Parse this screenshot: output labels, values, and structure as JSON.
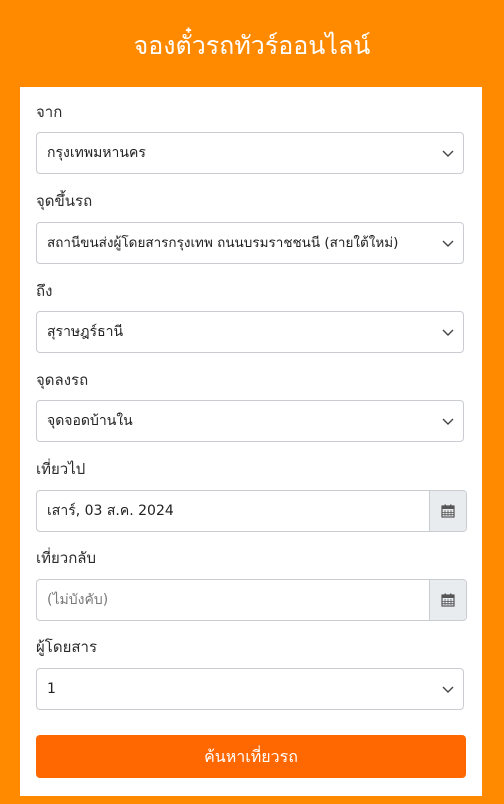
{
  "header": {
    "title": "จองตั๋วรถทัวร์ออนไลน์"
  },
  "form": {
    "from": {
      "label": "จาก",
      "value": "กรุงเทพมหานคร"
    },
    "pickup": {
      "label": "จุดขึ้นรถ",
      "value": "สถานีขนส่งผู้โดยสารกรุงเทพ ถนนบรมราชชนนี (สายใต้ใหม่)"
    },
    "to": {
      "label": "ถึง",
      "value": "สุราษฎร์ธานี"
    },
    "dropoff": {
      "label": "จุดลงรถ",
      "value": "จุดจอดบ้านใน"
    },
    "depart": {
      "label": "เที่ยวไป",
      "value": "เสาร์, 03 ส.ค. 2024"
    },
    "return": {
      "label": "เที่ยวกลับ",
      "placeholder": "(ไม่บังคับ)"
    },
    "passengers": {
      "label": "ผู้โดยสาร",
      "value": "1"
    },
    "submit_label": "ค้นหาเที่ยวรถ"
  },
  "colors": {
    "background": "#FF8A00",
    "button": "#FF6800",
    "card": "#FFFFFF"
  }
}
